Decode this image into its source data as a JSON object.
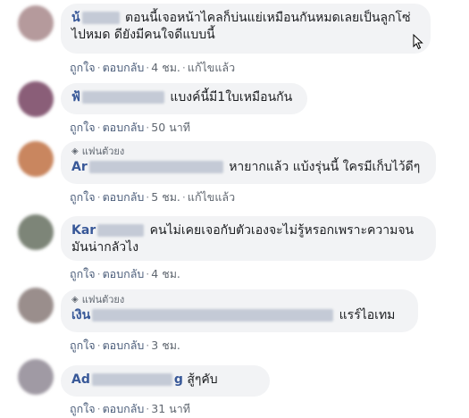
{
  "actions": {
    "like": "ถูกใจ",
    "reply": "ตอบกลับ",
    "edited": "แก้ไขแล้ว"
  },
  "badge_label": "แฟนตัวยง",
  "colors": {
    "bubble": "#f2f3f5",
    "name": "#385898",
    "meta": "#606770",
    "redaction": "#c4cad6"
  },
  "comments": [
    {
      "name_visible": "น้",
      "text_line1": "ตอนนี้เจอหน้าไคลก็บ่นแย่เหมือนกันหมดเลยเป็นลูกโซ่",
      "text_line2": "ไปหมด ดียังมีคนใจดีแบบนี้",
      "time": "4 ชม.",
      "edited": true
    },
    {
      "name_visible": "ฟ้",
      "text": "แบงค์นี้มี1ใบเหมือนกัน",
      "time": "50 นาที",
      "edited": false
    },
    {
      "badge": true,
      "name_visible": "Ar",
      "text": "หายากแล้ว แบ้งรุ่นนี้ ใครมีเก็บไว้ดีๆ",
      "time": "5 ชม.",
      "edited": true
    },
    {
      "name_visible": "Kar",
      "text_line1": "คนไม่เคยเจอกับตัวเองจะไม่รู้หรอกเพราะความจน",
      "text_line2": "มันน่ากลัวไง",
      "time": "4 ชม.",
      "edited": false
    },
    {
      "badge": true,
      "name_visible": "เงิน",
      "text": "แรร์ไอเทม",
      "time": "3 ชม.",
      "edited": false
    },
    {
      "name_visible": "Ad",
      "name_end": "g",
      "text": "สู้ๆคับ",
      "time": "31 นาที",
      "edited": false
    }
  ]
}
